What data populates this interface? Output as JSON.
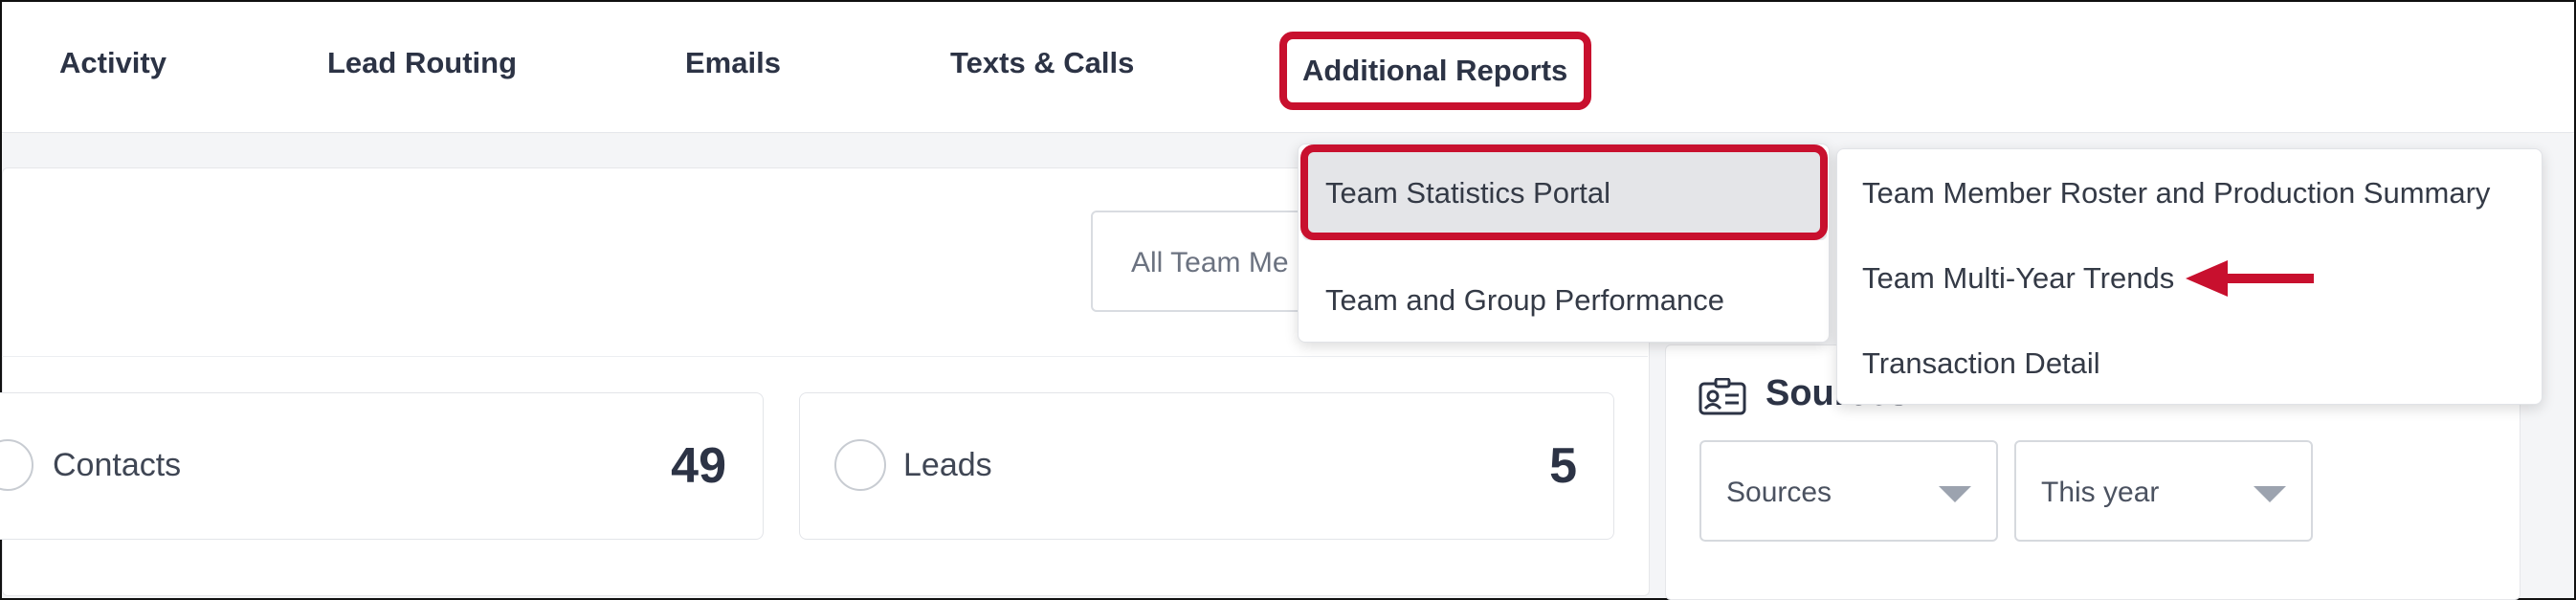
{
  "nav": {
    "items": [
      {
        "label": "Activity"
      },
      {
        "label": "Lead Routing"
      },
      {
        "label": "Emails"
      },
      {
        "label": "Texts & Calls"
      },
      {
        "label": "Additional Reports"
      }
    ]
  },
  "team_filter": {
    "value": "All Team Me"
  },
  "stats": [
    {
      "label": "Contacts",
      "value": "49"
    },
    {
      "label": "Leads",
      "value": "5"
    }
  ],
  "sources": {
    "title": "Sources",
    "icon": "contact-card-icon",
    "filters": [
      {
        "value": "Sources"
      },
      {
        "value": "This year"
      }
    ]
  },
  "reports_menu": {
    "items": [
      {
        "label": "Team Statistics Portal"
      },
      {
        "label": "Team and Group Performance"
      }
    ]
  },
  "submenu": {
    "items": [
      {
        "label": "Team Member Roster and Production Summary"
      },
      {
        "label": "Team Multi-Year Trends"
      },
      {
        "label": "Transaction Detail"
      }
    ]
  },
  "annotation": {
    "color": "#c8102e",
    "arrow_icon": "left-arrow-icon"
  }
}
